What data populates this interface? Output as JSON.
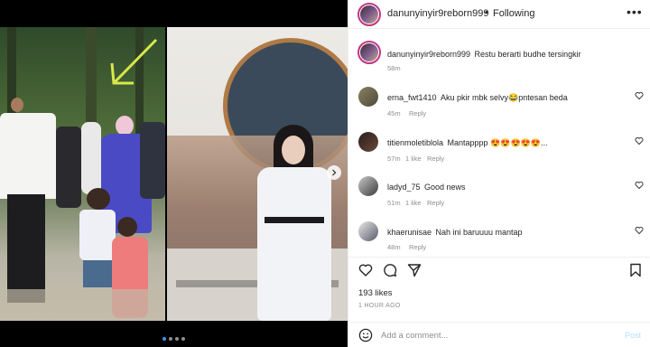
{
  "post": {
    "username": "danunyinyir9reborn999",
    "follow_status": "Following",
    "separator": "•",
    "more_icon": "more-dots-icon",
    "caption": "Restu berarti budhe tersingkir",
    "caption_time": "58m"
  },
  "comments": [
    {
      "user": "erna_fwt1410",
      "text": "Aku pkir mbk selvy😂pntesan beda",
      "time": "45m",
      "likes": "",
      "reply": "Reply"
    },
    {
      "user": "titienmoletiblola",
      "text": "Mantapppp 😍😍😍😍😍...",
      "time": "57m",
      "likes": "1 like",
      "reply": "Reply"
    },
    {
      "user": "ladyd_75",
      "text": "Good news",
      "time": "51m",
      "likes": "1 like",
      "reply": "Reply"
    },
    {
      "user": "khaerunisae",
      "text": "Nah ini baruuuu mantap",
      "time": "48m",
      "likes": "",
      "reply": "Reply"
    }
  ],
  "actions": {
    "like_icon": "heart-outline-icon",
    "comment_icon": "comment-bubble-icon",
    "share_icon": "paper-plane-icon",
    "save_icon": "bookmark-icon"
  },
  "likes": "193 likes",
  "time_ago": "1 HOUR AGO",
  "comment_box": {
    "placeholder": "Add a comment...",
    "value": "",
    "post_label": "Post",
    "emoji_icon": "smiley-icon"
  },
  "media": {
    "total_slides": 4,
    "active_slide": 1
  },
  "colors": {
    "accent_blue": "#3897f0",
    "post_disabled": "#b2dffc",
    "muted_text": "#8e8e8e",
    "border": "#efefef",
    "arrow_annotation": "#d8e84a"
  }
}
